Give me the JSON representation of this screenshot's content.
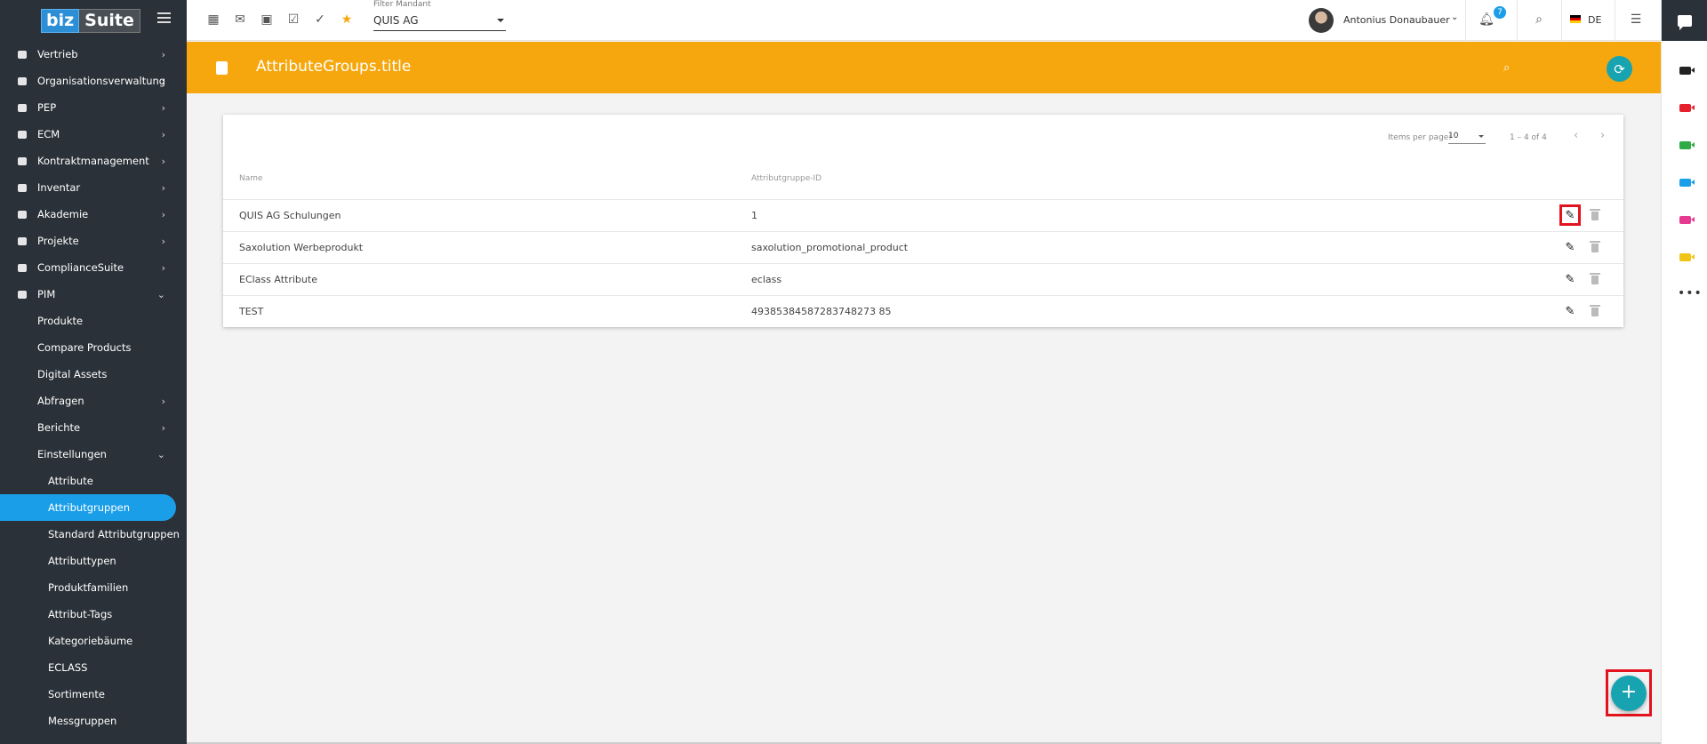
{
  "app": {
    "logo_left": "biz",
    "logo_right": "Suite"
  },
  "sidebar": {
    "items": [
      {
        "label": "Vertrieb",
        "chevron": "›"
      },
      {
        "label": "Organisationsverwaltung",
        "chevron": "›"
      },
      {
        "label": "PEP",
        "chevron": "›"
      },
      {
        "label": "ECM",
        "chevron": "›"
      },
      {
        "label": "Kontraktmanagement",
        "chevron": "›"
      },
      {
        "label": "Inventar",
        "chevron": "›"
      },
      {
        "label": "Akademie",
        "chevron": "›"
      },
      {
        "label": "Projekte",
        "chevron": "›"
      },
      {
        "label": "ComplianceSuite",
        "chevron": "›"
      },
      {
        "label": "PIM",
        "chevron": "⌄"
      },
      {
        "label": "Produkte"
      },
      {
        "label": "Compare Products"
      },
      {
        "label": "Digital Assets"
      },
      {
        "label": "Abfragen",
        "chevron": "›"
      },
      {
        "label": "Berichte",
        "chevron": "›"
      },
      {
        "label": "Einstellungen",
        "chevron": "⌄"
      },
      {
        "label": "Attribute"
      },
      {
        "label": "Attributgruppen"
      },
      {
        "label": "Standard Attributgruppen"
      },
      {
        "label": "Attributtypen"
      },
      {
        "label": "Produktfamilien"
      },
      {
        "label": "Attribut-Tags"
      },
      {
        "label": "Kategoriebäume"
      },
      {
        "label": "ECLASS"
      },
      {
        "label": "Sortimente"
      },
      {
        "label": "Messgruppen"
      }
    ]
  },
  "topbar": {
    "icons": [
      "calendar-icon",
      "mail-icon",
      "contact-icon",
      "checkbox-icon",
      "double-check-icon",
      "star-icon"
    ],
    "mandant_label": "Filter Mandant",
    "mandant_value": "QUIS AG",
    "user_name": "Antonius Donaubauer",
    "notification_count": "7",
    "language": "DE"
  },
  "header": {
    "title": "AttributeGroups.title",
    "color": "#f6a70d"
  },
  "table": {
    "items_per_page_label": "Items per page:",
    "items_per_page": "10",
    "range": "1 – 4 of 4",
    "columns": [
      "Name",
      "Attributgruppe-ID"
    ],
    "rows": [
      {
        "name": "QUIS AG Schulungen",
        "id": "1"
      },
      {
        "name": "Saxolution Werbeprodukt",
        "id": "saxolution_promotional_product"
      },
      {
        "name": "EClass Attribute",
        "id": "eclass"
      },
      {
        "name": "TEST",
        "id": "49385384587283748273 85"
      }
    ]
  },
  "rightrail": {
    "camera_colors": [
      "#222222",
      "#e5212e",
      "#2eab44",
      "#1a9ee8",
      "#e53a8f",
      "#f0c419"
    ]
  },
  "fab": {
    "label": "+"
  }
}
